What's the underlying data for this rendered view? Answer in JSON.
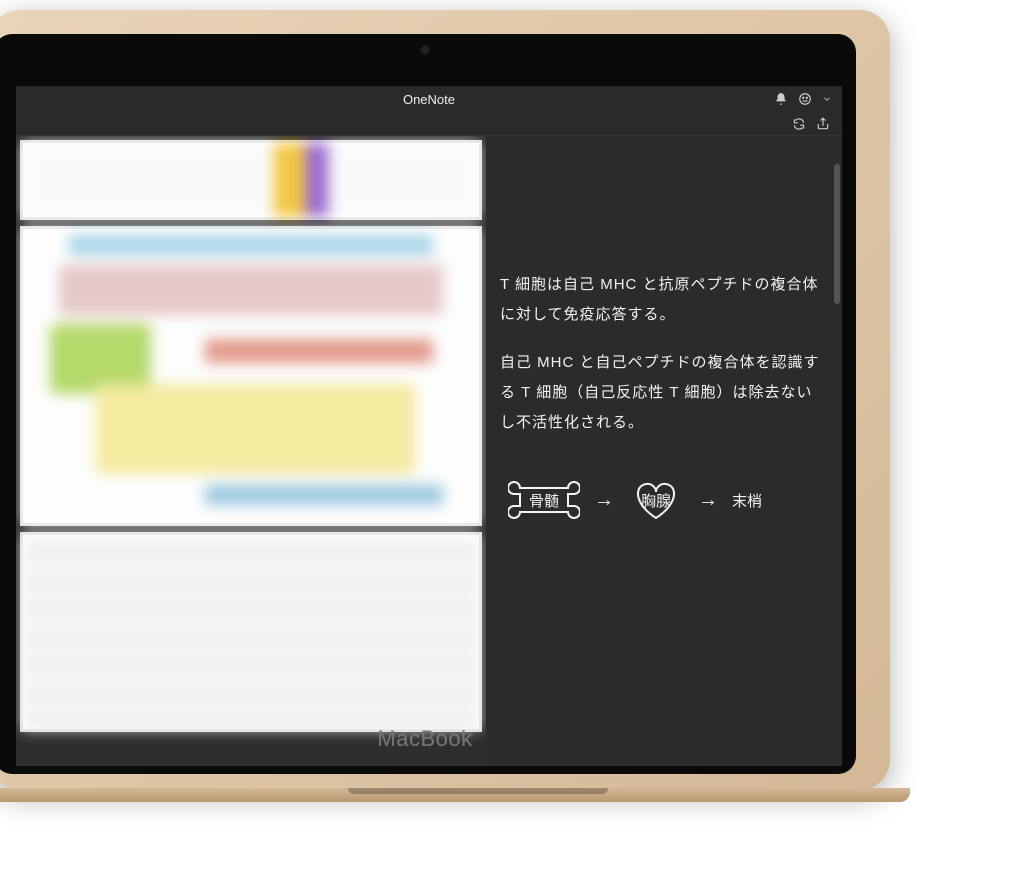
{
  "app": {
    "title": "OneNote",
    "device_label": "MacBook"
  },
  "notes": {
    "para1": "T 細胞は自己 MHC と抗原ペプチドの複合体に対して免疫応答する。",
    "para2": "自己 MHC と自己ペプチドの複合体を認識する T 細胞（自己反応性 T 細胞）は除去ないし不活性化される。"
  },
  "diagram": {
    "node1": "骨髄",
    "node2": "胸腺",
    "node3": "末梢"
  }
}
